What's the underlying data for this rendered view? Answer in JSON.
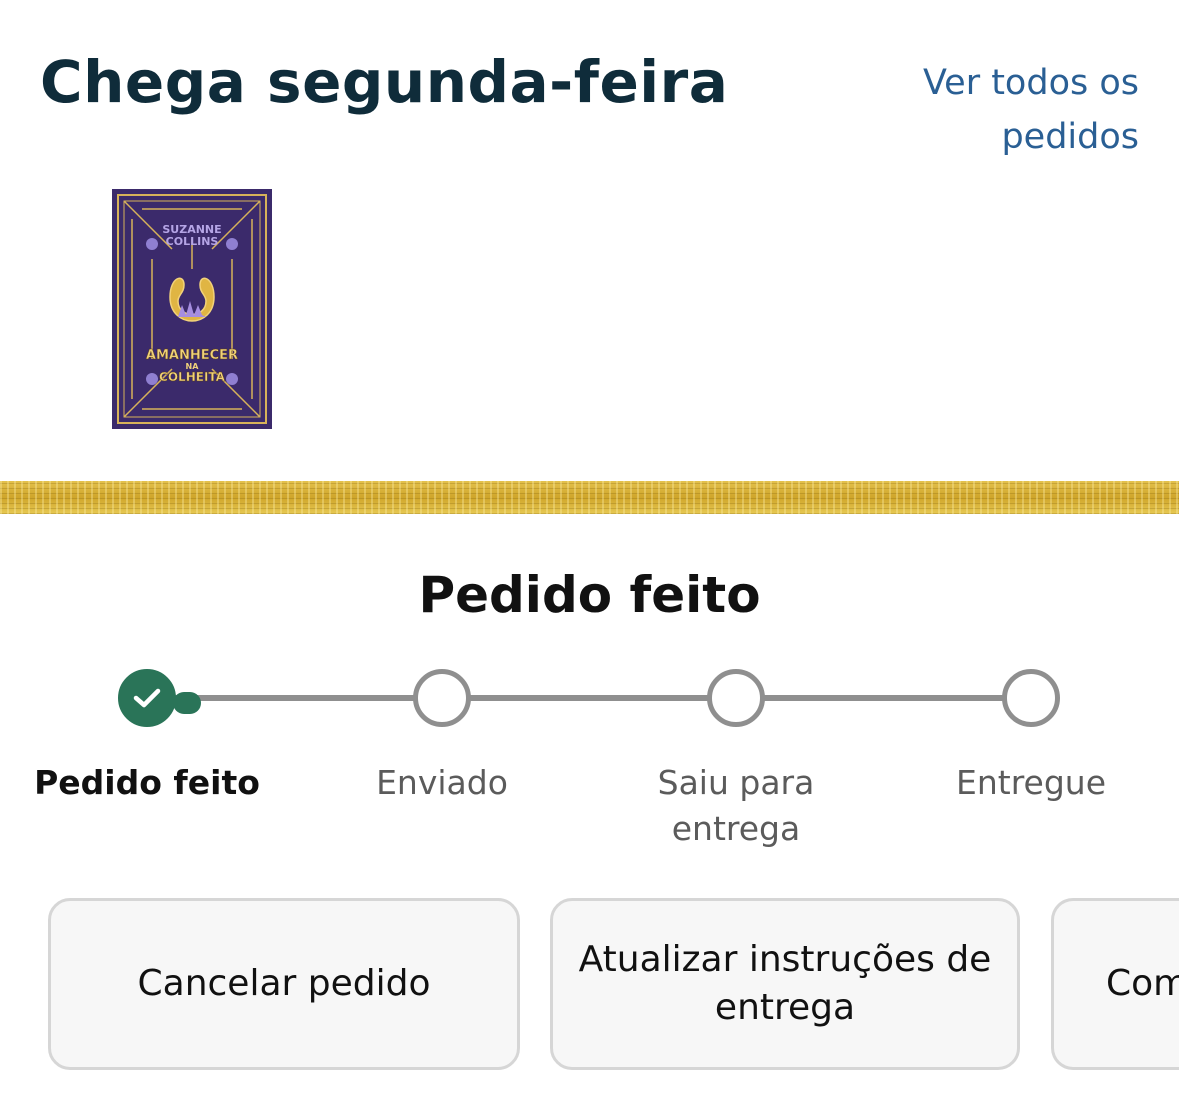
{
  "header": {
    "title": "Chega segunda-feira",
    "see_all_line1": "Ver todos os",
    "see_all_line2": "pedidos"
  },
  "book": {
    "author_line1": "SUZANNE",
    "author_line2": "COLLINS",
    "title_line1": "AMANHECER",
    "title_line2": "NA",
    "title_line3": "COLHEITA"
  },
  "status": {
    "title": "Pedido feito",
    "steps": [
      {
        "label": "Pedido feito",
        "state": "done"
      },
      {
        "label": "Enviado",
        "state": "pending"
      },
      {
        "label": "Saiu para entrega",
        "state": "pending"
      },
      {
        "label": "Entregue",
        "state": "pending"
      }
    ]
  },
  "actions": [
    {
      "label": "Cancelar pedido"
    },
    {
      "label": "Atualizar instruções de entrega"
    },
    {
      "label": "Com"
    }
  ],
  "colors": {
    "title": "#0f2c3a",
    "link": "#2a5f94",
    "step_done": "#2a7458",
    "step_pending": "#8f8f8f",
    "book_purple": "#3b2a6b",
    "book_gold": "#d7b25a",
    "band_gold": "#d4ac32"
  }
}
